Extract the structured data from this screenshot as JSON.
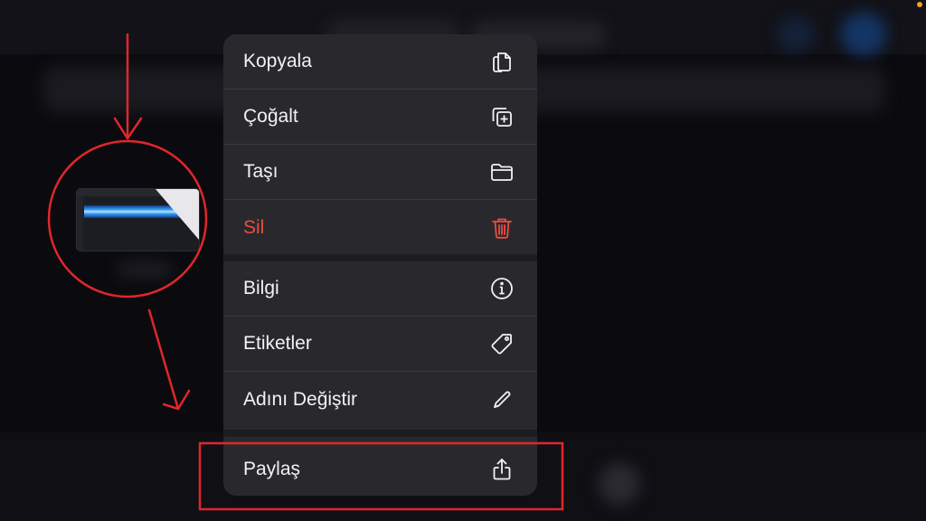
{
  "menu": {
    "items": [
      {
        "label": "Kopyala",
        "icon": "copy-icon"
      },
      {
        "label": "Çoğalt",
        "icon": "duplicate-icon"
      },
      {
        "label": "Taşı",
        "icon": "folder-icon"
      },
      {
        "label": "Sil",
        "icon": "trash-icon",
        "destructive": true
      },
      {
        "label": "Bilgi",
        "icon": "info-icon"
      },
      {
        "label": "Etiketler",
        "icon": "tag-icon"
      },
      {
        "label": "Adını Değiştir",
        "icon": "pencil-icon"
      },
      {
        "label": "Paylaş",
        "icon": "share-icon"
      }
    ]
  },
  "colors": {
    "menu_background": "#29292d",
    "text": "#f2f2f5",
    "destructive": "#eb4d40",
    "annotation": "#e0262b",
    "background": "#0b0b0f"
  },
  "annotations": {
    "thumbnail_circle": "red-circle",
    "arrows": "red-arrows",
    "share_highlight": "red-rectangle"
  }
}
